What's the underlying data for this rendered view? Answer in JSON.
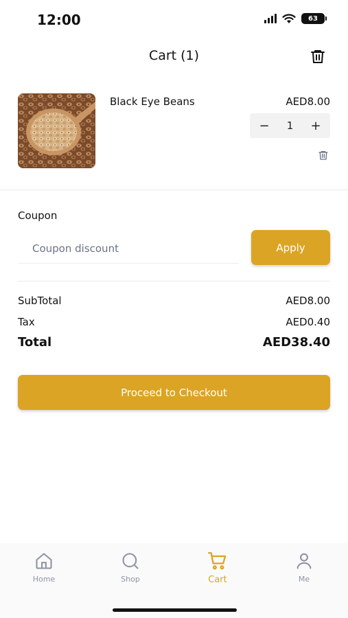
{
  "status_bar": {
    "time": "12:00",
    "battery": "63"
  },
  "header": {
    "title": "Cart (1)"
  },
  "cart_item": {
    "name": "Black Eye Beans",
    "price": "AED8.00",
    "quantity": "1",
    "decrement_symbol": "−",
    "increment_symbol": "+"
  },
  "coupon": {
    "label": "Coupon",
    "placeholder": "Coupon discount",
    "apply_label": "Apply"
  },
  "summary": {
    "subtotal_label": "SubTotal",
    "subtotal_value": "AED8.00",
    "tax_label": "Tax",
    "tax_value": "AED0.40",
    "total_label": "Total",
    "total_value": "AED38.40"
  },
  "checkout_label": "Proceed to Checkout",
  "tabs": [
    {
      "label": "Home",
      "icon": "home-icon"
    },
    {
      "label": "Shop",
      "icon": "search-icon"
    },
    {
      "label": "Cart",
      "icon": "cart-icon",
      "active": true
    },
    {
      "label": "Me",
      "icon": "person-icon"
    }
  ],
  "colors": {
    "accent": "#dba425",
    "inactive_tab": "#8d94a6",
    "text": "#111111"
  }
}
